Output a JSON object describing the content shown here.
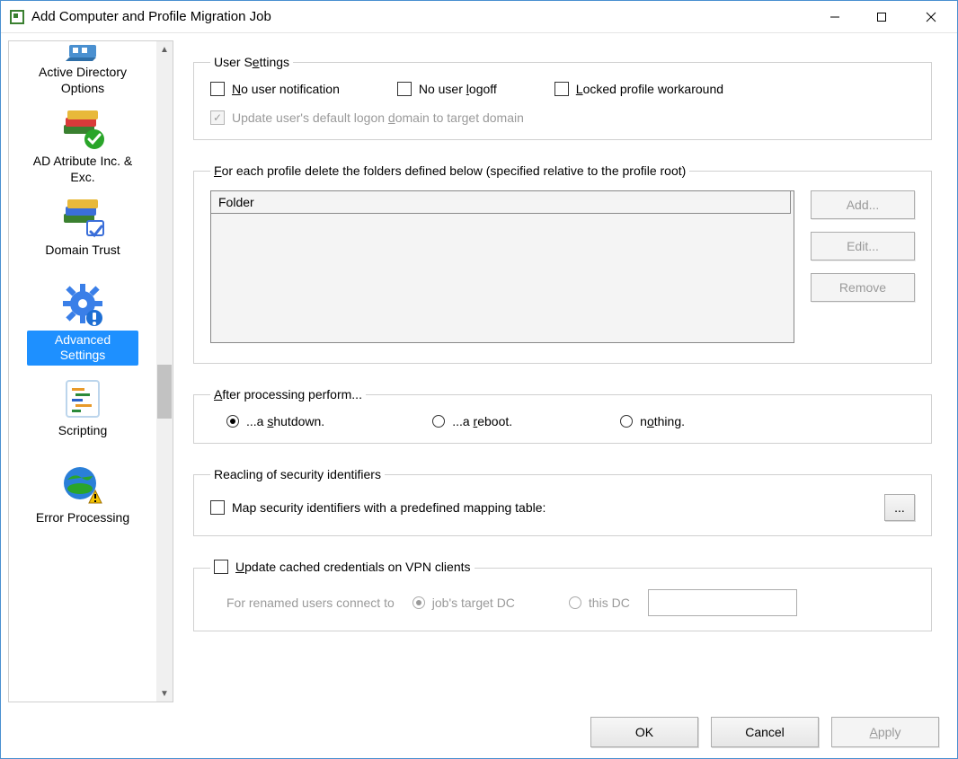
{
  "window": {
    "title": "Add Computer and Profile Migration Job"
  },
  "sidebar": {
    "items": [
      {
        "label": "Active Directory Options"
      },
      {
        "label": "AD Atribute Inc. & Exc."
      },
      {
        "label": "Domain Trust"
      },
      {
        "label": "Advanced Settings"
      },
      {
        "label": "Scripting"
      },
      {
        "label": "Error Processing"
      }
    ]
  },
  "groups": {
    "user_settings": {
      "legend": "User Settings",
      "no_notification": "No user notification",
      "no_logoff": "No user logoff",
      "locked_workaround": "Locked profile workaround",
      "update_domain": "Update user's default logon domain to target domain"
    },
    "delete_folders": {
      "legend": "For each profile delete the folders defined below (specified relative to the profile root)",
      "column_header": "Folder",
      "buttons": {
        "add": "Add...",
        "edit": "Edit...",
        "remove": "Remove"
      }
    },
    "after_processing": {
      "legend": "After processing perform...",
      "options": {
        "shutdown": "...a shutdown.",
        "reboot": "...a reboot.",
        "nothing": "nothing."
      },
      "selected": "shutdown"
    },
    "security_ids": {
      "legend": "Reacling of security identifiers",
      "map_label": "Map security identifiers with a predefined mapping table:",
      "browse": "..."
    },
    "vpn": {
      "checkbox_label": "Update cached credentials on VPN clients",
      "connect_label": "For renamed users connect to",
      "target_dc": "job's target DC",
      "this_dc": "this DC"
    }
  },
  "footer": {
    "ok": "OK",
    "cancel": "Cancel",
    "apply": "Apply"
  }
}
